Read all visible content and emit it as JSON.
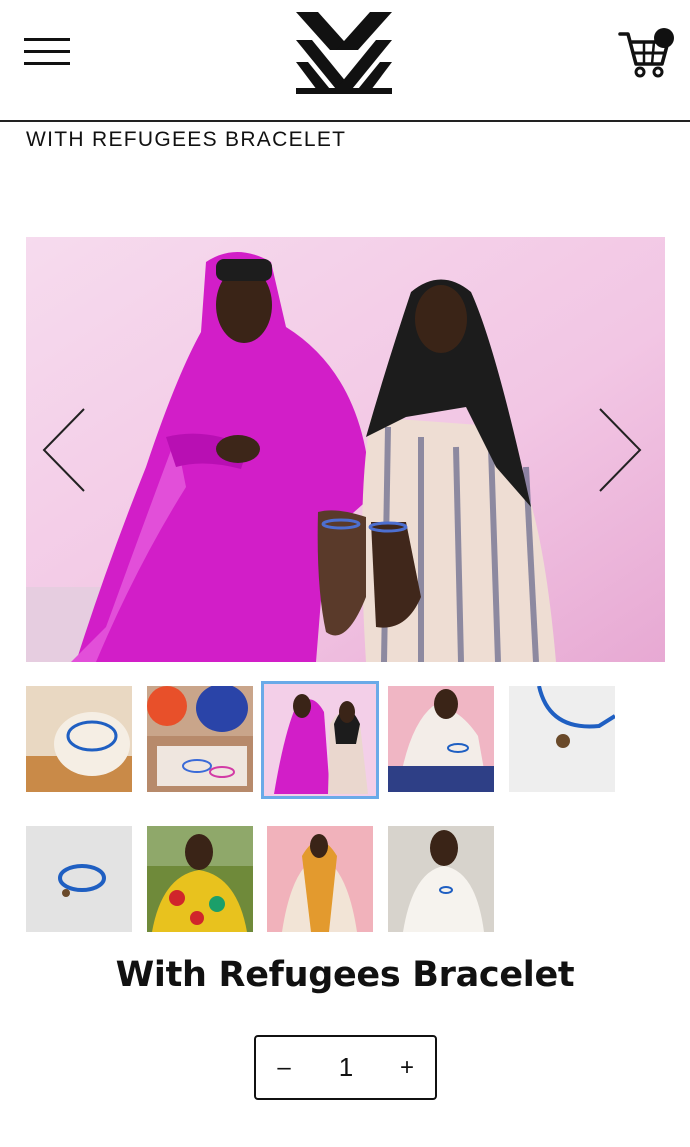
{
  "header": {
    "menu_icon": "hamburger-menu-icon",
    "logo_icon": "brand-logo-icon",
    "cart_icon": "shopping-cart-icon",
    "cart_badge_color": "#111111"
  },
  "breadcrumb": {
    "text": "WITH REFUGEES BRACELET"
  },
  "gallery": {
    "prev_icon": "chevron-left-icon",
    "next_icon": "chevron-right-icon",
    "active_thumbnail": 3,
    "active_color": "#6aaae8",
    "thumbnails_count": 9
  },
  "product": {
    "title": "With Refugees Bracelet"
  },
  "quantity": {
    "minus_label": "–",
    "value": "1",
    "plus_label": "+"
  }
}
